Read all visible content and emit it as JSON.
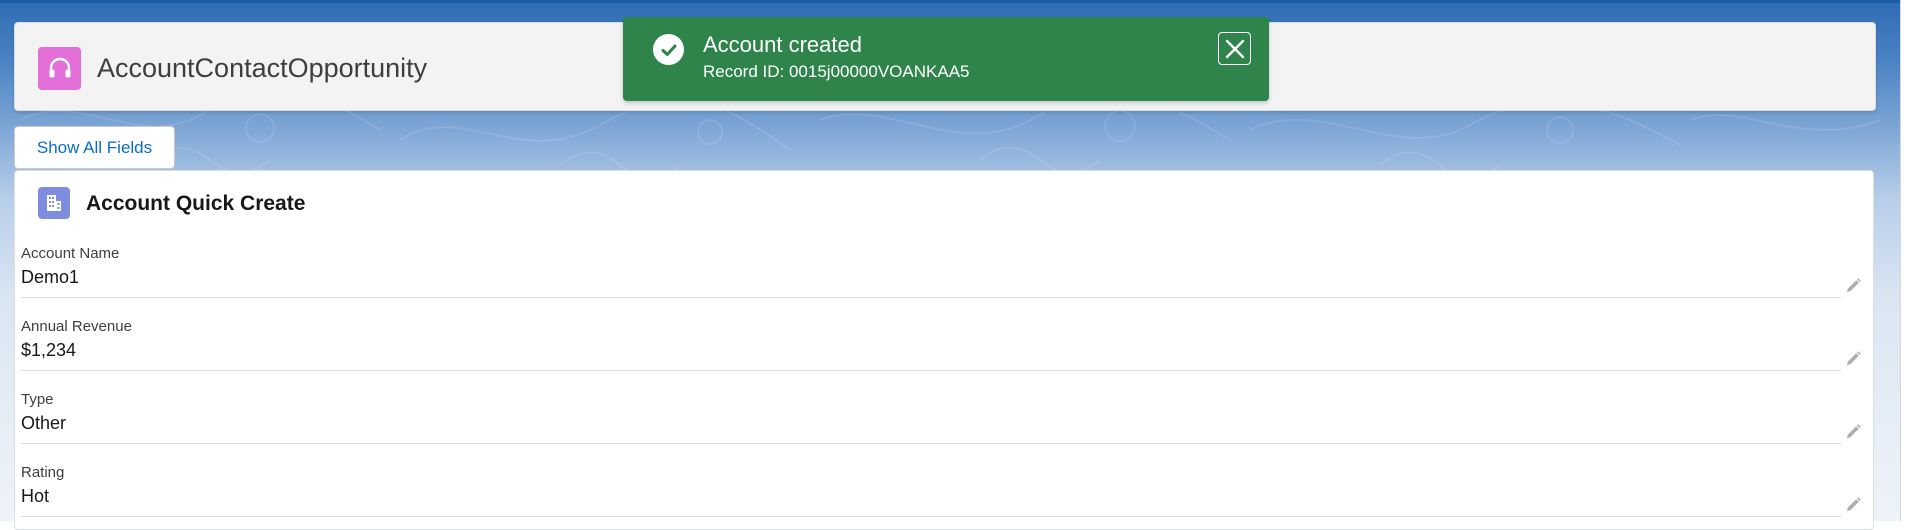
{
  "app": {
    "title": "AccountContactOpportunity",
    "icon": "headset-icon",
    "icon_color": "#e16fd7"
  },
  "toast": {
    "title": "Account created",
    "message": "Record ID: 0015j00000VOANKAA5",
    "color": "#2e844a",
    "status_icon": "success-check-icon",
    "close_icon": "close-icon"
  },
  "actions": {
    "show_all_fields": "Show All Fields"
  },
  "card": {
    "title": "Account Quick Create",
    "icon": "account-building-icon",
    "icon_color": "#7f8de1",
    "fields": [
      {
        "label": "Account Name",
        "value": "Demo1"
      },
      {
        "label": "Annual Revenue",
        "value": "$1,234"
      },
      {
        "label": "Type",
        "value": "Other"
      },
      {
        "label": "Rating",
        "value": "Hot"
      }
    ]
  },
  "colors": {
    "accent_link": "#0b6ec5",
    "header_bg": "#f3f3f3",
    "page_bg_top": "#2f6cb3"
  }
}
